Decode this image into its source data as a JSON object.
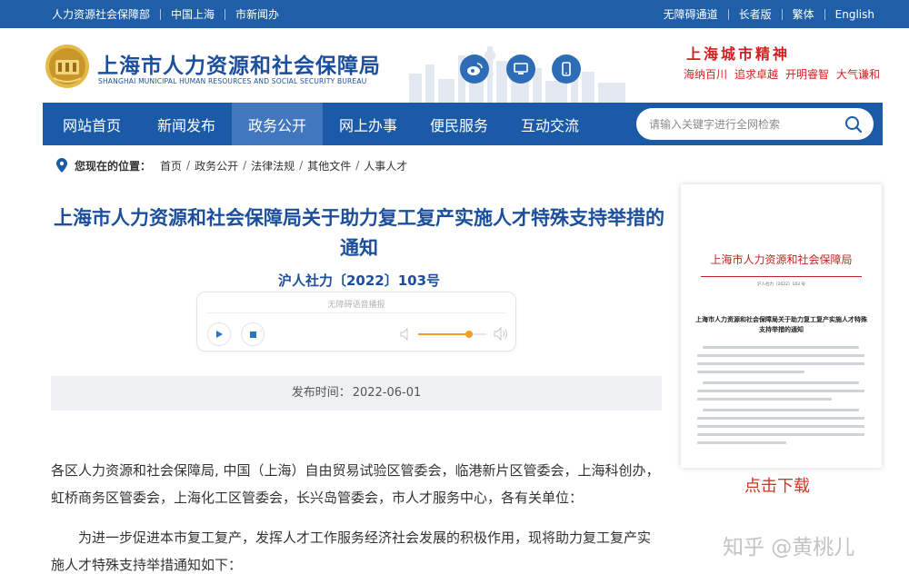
{
  "topbar": {
    "left_links": [
      "人力资源社会保障部",
      "中国上海",
      "市新闻办"
    ],
    "right_links": [
      "无障碍通道",
      "长者版",
      "繁体",
      "English"
    ]
  },
  "header": {
    "title": "上海市人力资源和社会保障局",
    "subtitle": "SHANGHAI MUNICIPAL HUMAN RESOURCES AND SOCIAL SECURITY BUREAU",
    "social_icons": [
      "weibo-icon",
      "computer-icon",
      "mobile-icon"
    ],
    "spirit_title": "上海城市精神",
    "spirit_words": [
      "海纳百川",
      "追求卓越",
      "开明睿智",
      "大气谦和"
    ]
  },
  "nav": {
    "items": [
      "网站首页",
      "新闻发布",
      "政务公开",
      "网上办事",
      "便民服务",
      "互动交流"
    ],
    "active_index": 2,
    "search_placeholder": "请输入关键字进行全网检索"
  },
  "breadcrumb": {
    "label": "您现在的位置：",
    "items": [
      "首页",
      "政务公开",
      "法律法规",
      "其他文件",
      "人事人才"
    ],
    "separator": "/"
  },
  "article": {
    "title": "上海市人力资源和社会保障局关于助力复工复产实施人才特殊支持举措的通知",
    "doc_number": "沪人社力〔2022〕103号",
    "player_title": "无障碍语音播报",
    "volume_level": 0.75,
    "publish_label": "发布时间：",
    "publish_date": "2022-06-01",
    "paragraph1": "各区人力资源和社会保障局, 中国（上海）自由贸易试验区管委会，临港新片区管委会，上海科创办，虹桥商务区管委会，上海化工区管委会，长兴岛管委会，市人才服务中心，各有关单位：",
    "paragraph2": "为进一步促进本市复工复产，发挥人才工作服务经济社会发展的积极作用，现将助力复工复产实施人才特殊支持举措通知如下："
  },
  "preview": {
    "header": "上海市人力资源和社会保障局",
    "doc_number": "沪人社力〔2022〕103 号",
    "title": "上海市人力资源和社会保障局关于助力复工复产实施人才特殊支持举措的通知",
    "download_label": "点击下载"
  },
  "watermark": "知乎 @黄桃儿",
  "colors": {
    "primary": "#1a5aa6",
    "nav_active": "#4177be",
    "title_blue": "#1b4f9c",
    "accent_red": "#d11f1f",
    "volume_orange": "#f0a020"
  }
}
